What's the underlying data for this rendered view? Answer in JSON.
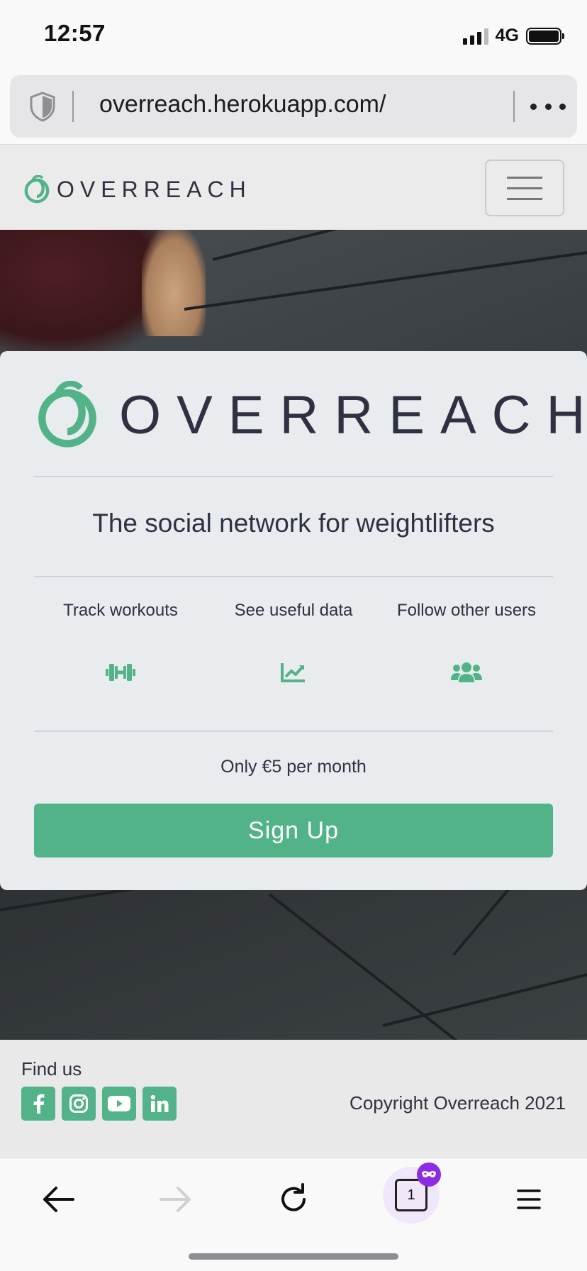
{
  "status_bar": {
    "time": "12:57",
    "network": "4G"
  },
  "browser": {
    "url": "overreach.herokuapp.com/",
    "tab_count": "1",
    "icons": [
      "shield-icon",
      "more-icon",
      "back-arrow-icon",
      "forward-arrow-icon",
      "reload-icon",
      "tabs-icon",
      "private-mask-icon",
      "menu-icon"
    ]
  },
  "site": {
    "brand": "OVERREACH",
    "brand_color": "#52b388",
    "text_color": "#2f3142"
  },
  "card": {
    "tagline": "The social network for weightlifters",
    "features": [
      {
        "label": "Track workouts",
        "icon": "dumbbell-icon"
      },
      {
        "label": "See useful data",
        "icon": "chart-line-icon"
      },
      {
        "label": "Follow other users",
        "icon": "users-icon"
      }
    ],
    "price": "Only €5 per month",
    "signup_label": "Sign Up"
  },
  "footer": {
    "find_us": "Find us",
    "socials": [
      "facebook-icon",
      "instagram-icon",
      "youtube-icon",
      "linkedin-icon"
    ],
    "copyright": "Copyright Overreach 2021"
  }
}
